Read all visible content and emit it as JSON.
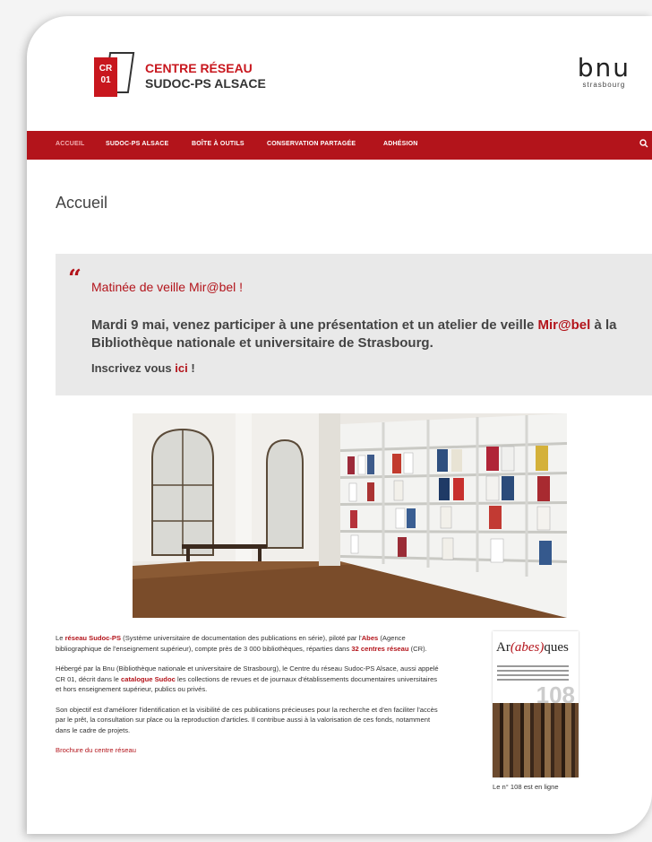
{
  "header": {
    "logo_code_line1": "CR",
    "logo_code_line2": "01",
    "logo_line1": "CENTRE RÉSEAU",
    "logo_line2": "SUDOC-PS ALSACE",
    "partner_logo": "bnu",
    "partner_city": "strasbourg"
  },
  "nav": {
    "items": [
      {
        "label": "ACCUEIL"
      },
      {
        "label": "SUDOC-PS ALSACE"
      },
      {
        "label": "BOÎTE À OUTILS"
      },
      {
        "label": "CONSERVATION PARTAGÉE"
      },
      {
        "label": "ADHÉSION"
      }
    ],
    "search_icon": "search-icon"
  },
  "page": {
    "title": "Accueil"
  },
  "announcement": {
    "quote_icon": "quote-icon",
    "title": "Matinée de veille Mir@bel !",
    "body_part1": "Mardi 9 mai, venez participer à une présentation et un atelier de veille",
    "body_link": "Mir@bel",
    "body_part2": "à la Bibliothèque nationale et universitaire de Strasbourg.",
    "cta_text": "Inscrivez vous",
    "cta_link": "ici",
    "cta_suffix": "!"
  },
  "intro": {
    "p1": {
      "t1": "Le",
      "link1": "réseau Sudoc-PS",
      "t2": "(Système universitaire de documentation des publications en série), piloté par l'",
      "link2": "Abes",
      "t3": "(Agence bibliographique de l'enseignement supérieur), compte près de 3 000 bibliothèques, réparties dans",
      "link3": "32 centres réseau",
      "t4": "(CR)."
    },
    "p2": {
      "t1": "Hébergé par la Bnu (Bibliothèque nationale et universitaire de Strasbourg), le Centre du réseau Sudoc-PS Alsace, aussi appelé CR 01, décrit dans le",
      "link1": "catalogue Sudoc",
      "t2": "les collections de revues et de journaux d'établissements documentaires universitaires et hors enseignement supérieur, publics ou privés."
    },
    "p3": "Son objectif est d'améliorer l'identification et la visibilité de ces publications précieuses pour la recherche et d'en faciliter l'accès par le prêt, la consultation sur place ou la reproduction d'articles. Il contribue aussi à la valorisation de ces fonds, notamment dans le cadre de projets.",
    "brochure_link": "Brochure du centre réseau"
  },
  "sidebar": {
    "cover_title_part1": "Ar",
    "cover_title_part2": "(abes)",
    "cover_title_part3": "ques",
    "cover_number": "108",
    "caption": "Le n° 108 est en ligne"
  },
  "colors": {
    "brand_red": "#b3141b",
    "nav_red": "#b3141b",
    "announcement_bg": "#e9e9e9"
  }
}
